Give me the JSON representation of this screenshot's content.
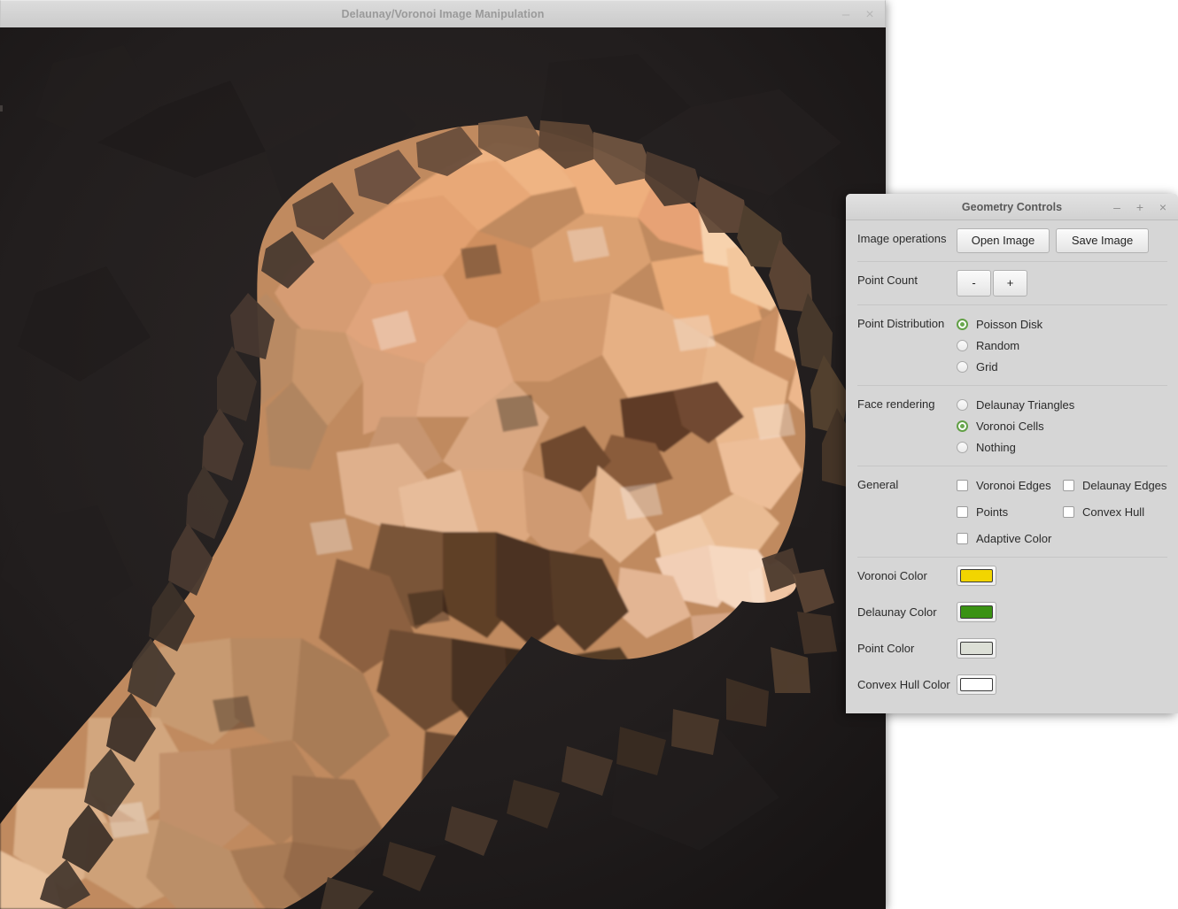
{
  "main_window": {
    "title": "Delaunay/Voronoi Image Manipulation",
    "minimize_label": "–",
    "close_label": "×",
    "canvas": {
      "background_color": "#1e1b1b",
      "subject": "dog head rendered as voronoi cells"
    }
  },
  "dialog": {
    "title": "Geometry Controls",
    "minimize_label": "–",
    "maximize_label": "+",
    "close_label": "×",
    "rows": {
      "image_operations": {
        "label": "Image operations",
        "open_button": "Open Image",
        "save_button": "Save Image"
      },
      "point_count": {
        "label": "Point Count",
        "decrement_button": "-",
        "increment_button": "+"
      },
      "point_distribution": {
        "label": "Point Distribution",
        "options": [
          {
            "label": "Poisson Disk",
            "selected": true
          },
          {
            "label": "Random",
            "selected": false
          },
          {
            "label": "Grid",
            "selected": false
          }
        ]
      },
      "face_rendering": {
        "label": "Face rendering",
        "options": [
          {
            "label": "Delaunay Triangles",
            "selected": false
          },
          {
            "label": "Voronoi Cells",
            "selected": true
          },
          {
            "label": "Nothing",
            "selected": false
          }
        ]
      },
      "general": {
        "label": "General",
        "checkboxes": [
          {
            "label": "Voronoi Edges",
            "checked": false
          },
          {
            "label": "Delaunay Edges",
            "checked": false
          },
          {
            "label": "Points",
            "checked": false
          },
          {
            "label": "Convex Hull",
            "checked": false
          },
          {
            "label": "Adaptive Color",
            "checked": false
          }
        ]
      },
      "voronoi_color": {
        "label": "Voronoi Color",
        "color": "#f2d500"
      },
      "delaunay_color": {
        "label": "Delaunay Color",
        "color": "#3a9213"
      },
      "point_color": {
        "label": "Point Color",
        "color": "#dcdfd6"
      },
      "convex_hull_color": {
        "label": "Convex Hull Color",
        "color": "#ffffff"
      }
    }
  },
  "theme": {
    "selected_radio_color": "#6aa84f",
    "dialog_background": "#d6d6d6",
    "titlebar_background": "#d4d4d4"
  }
}
